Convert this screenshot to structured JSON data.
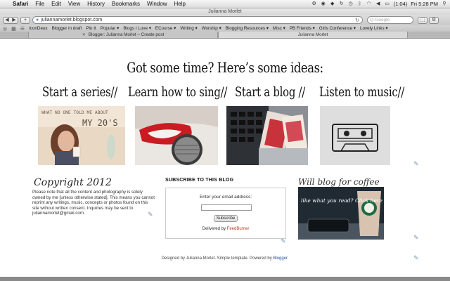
{
  "menubar": {
    "app": "Safari",
    "items": [
      "File",
      "Edit",
      "View",
      "History",
      "Bookmarks",
      "Window",
      "Help"
    ],
    "battery": "(1:04)",
    "clock": "Fri 5:28 PM"
  },
  "window": {
    "title": "Julianna Morlet",
    "url": "juliannamorlet.blogspot.com",
    "search_placeholder": "Q-Google"
  },
  "bookmarks": [
    "IconDeux",
    "Blogger in draft",
    "Pin It",
    "Popular ▾",
    "Blogs I Love ▾",
    "ECourse ▾",
    "Writing ▾",
    "Worship ▾",
    "Blogging Resources ▾",
    "Misc ▾",
    "PB Friends ▾",
    "Girls Conference ▾",
    "Lovely Links ▾"
  ],
  "tabs": [
    {
      "label": "Blogger: Julianna Morlet – Create post",
      "active": false
    },
    {
      "label": "Julianna Morlet",
      "active": true
    }
  ],
  "page": {
    "headline": "Got some time? Here’s some ideas:",
    "ideas": [
      {
        "label": "Start a series//",
        "thumb_text": "WHAT NO ONE TOLD ME ABOUT",
        "thumb_text2": "MY 20'S"
      },
      {
        "label": "Learn how to sing//",
        "thumb_text": "",
        "thumb_text2": ""
      },
      {
        "label": "Start a blog //",
        "thumb_text": "",
        "thumb_text2": ""
      },
      {
        "label": "Listen to music//",
        "thumb_text": "",
        "thumb_text2": ""
      }
    ],
    "copyright": {
      "title": "Copyright 2012",
      "text": "Please note that all the content and photography is solely owned by me [unless otherwise stated]. This means you cannot reprint any writings, music, concepts or photos found on this site without written consent. Inquiries may be sent to juliannamorlet@gmail.com."
    },
    "subscribe": {
      "title": "SUBSCRIBE TO THIS BLOG",
      "label": "Enter your email address:",
      "button": "Subscribe",
      "footer_prefix": "Delivered by ",
      "footer_link": "FeedBurner"
    },
    "coffee": {
      "title": "Will blog for coffee",
      "overlay": "like what you read? Click here"
    },
    "footer": {
      "prefix": "Designed by Julianna Morlet. Simple template. Powered by ",
      "link": "Blogger",
      "suffix": "."
    }
  }
}
